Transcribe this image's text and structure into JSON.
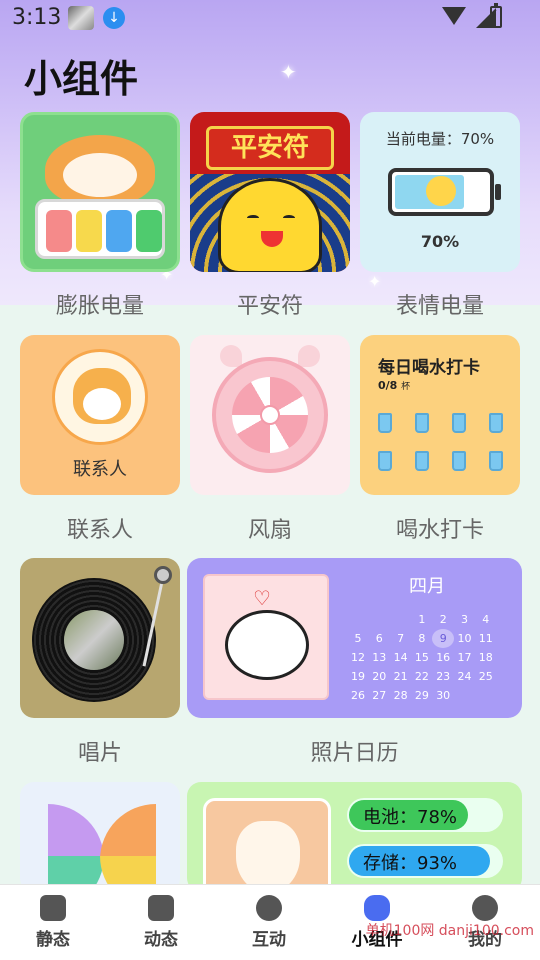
{
  "status_bar": {
    "time": "3:13"
  },
  "header": {
    "title": "小组件"
  },
  "widgets": {
    "battery_swell": {
      "label": "膨胀电量",
      "cell_colors": [
        "#f58a8a",
        "#f7d94c",
        "#4fa7f0",
        "#4fcb6e"
      ]
    },
    "amulet": {
      "label": "平安符",
      "sign_text": "平安符"
    },
    "emoji_battery": {
      "label": "表情电量",
      "title": "当前电量：70%",
      "percent": "70%",
      "level": 0.7
    },
    "contact": {
      "label": "联系人",
      "inner_text": "联系人"
    },
    "fan": {
      "label": "风扇"
    },
    "water": {
      "label": "喝水打卡",
      "title": "每日喝水打卡",
      "count": "0/8",
      "count_unit": "杯",
      "cups": 8
    },
    "record": {
      "label": "唱片"
    },
    "calendar": {
      "label": "照片日历",
      "month": "四月",
      "today": 9,
      "first_weekday": 3,
      "days": 30
    },
    "pinwheel": {
      "label": ""
    },
    "status": {
      "battery_text": "电池：78%",
      "battery_level": 0.78,
      "battery_color": "#3ec75a",
      "storage_text": "存储：93%",
      "storage_level": 0.93,
      "storage_color": "#2fa8f0"
    }
  },
  "nav": {
    "items": [
      {
        "label": "静态"
      },
      {
        "label": "动态"
      },
      {
        "label": "互动"
      },
      {
        "label": "小组件"
      },
      {
        "label": "我的"
      }
    ],
    "active": 3
  },
  "watermark": "单机100网 danji100.com",
  "accent_color": "#4a6cf0"
}
